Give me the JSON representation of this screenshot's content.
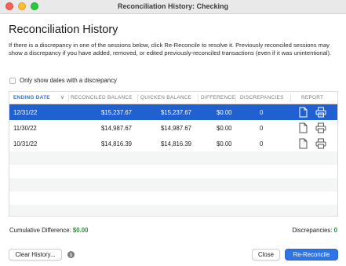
{
  "window": {
    "title": "Reconciliation History: Checking"
  },
  "heading": "Reconciliation History",
  "description": "If there is a discrepancy in one of the sessions below, click Re-Reconcile to resolve it. Previously reconciled sessions may show a discrepancy if you have added, removed, or edited previously-reconciled transactions (even if it was unintentional).",
  "filter": {
    "label": "Only show dates with a discrepancy",
    "checked": false
  },
  "table": {
    "columns": [
      "ENDING DATE",
      "RECONCILED BALANCE",
      "QUICKEN BALANCE",
      "DIFFERENCE",
      "DISCREPANCIES",
      "REPORT"
    ],
    "rows": [
      {
        "date": "12/31/22",
        "reconciled": "$15,237.67",
        "quicken": "$15,237.67",
        "difference": "$0.00",
        "discrepancies": "0",
        "selected": true
      },
      {
        "date": "11/30/22",
        "reconciled": "$14,987.67",
        "quicken": "$14,987.67",
        "difference": "$0.00",
        "discrepancies": "0",
        "selected": false
      },
      {
        "date": "10/31/22",
        "reconciled": "$14,816.39",
        "quicken": "$14,816.39",
        "difference": "$0.00",
        "discrepancies": "0",
        "selected": false
      }
    ]
  },
  "footer": {
    "cumulative_label": "Cumulative Difference:",
    "cumulative_value": "$0.00",
    "discrepancies_label": "Discrepancies:",
    "discrepancies_value": "0"
  },
  "buttons": {
    "clear_history": "Clear History...",
    "info": "i",
    "close": "Close",
    "re_reconcile": "Re-Reconcile"
  },
  "colors": {
    "selection": "#2060d0",
    "accent": "#2f73e8",
    "positive": "#2e8b3d"
  },
  "icons": {
    "report": "document-icon",
    "print": "printer-icon"
  }
}
